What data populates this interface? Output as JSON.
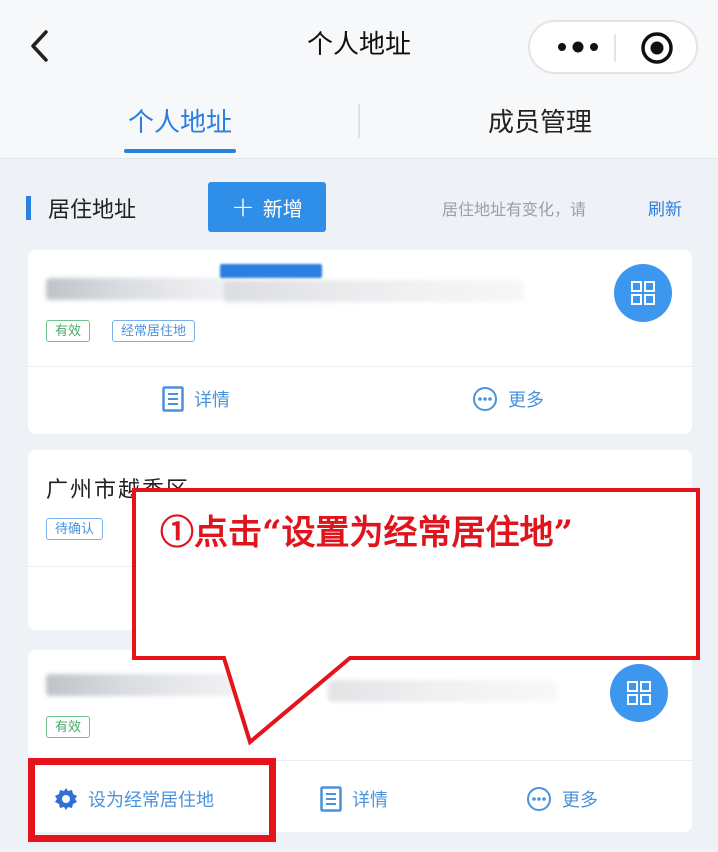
{
  "nav": {
    "title": "个人地址"
  },
  "tabs": [
    {
      "label": "个人地址",
      "active": true
    },
    {
      "label": "成员管理",
      "active": false
    }
  ],
  "section": {
    "title": "居住地址",
    "add_label": "新增",
    "hint": "居住地址有变化，请",
    "refresh": "刷新"
  },
  "cards": [
    {
      "tags": [
        "有效",
        "经常居住地"
      ],
      "actions": {
        "detail": "详情",
        "more": "更多"
      }
    },
    {
      "address": "广州市越秀区",
      "tags": [
        "待确认"
      ]
    },
    {
      "tags": [
        "有效"
      ],
      "actions": {
        "set_default": "设为经常居住地",
        "detail": "详情",
        "more": "更多"
      }
    }
  ],
  "annotation": {
    "text": "①点击“设置为经常居住地”"
  },
  "colors": {
    "accent": "#2a7fe0",
    "annotation_red": "#e5131b",
    "tag_green": "#46a86a"
  }
}
